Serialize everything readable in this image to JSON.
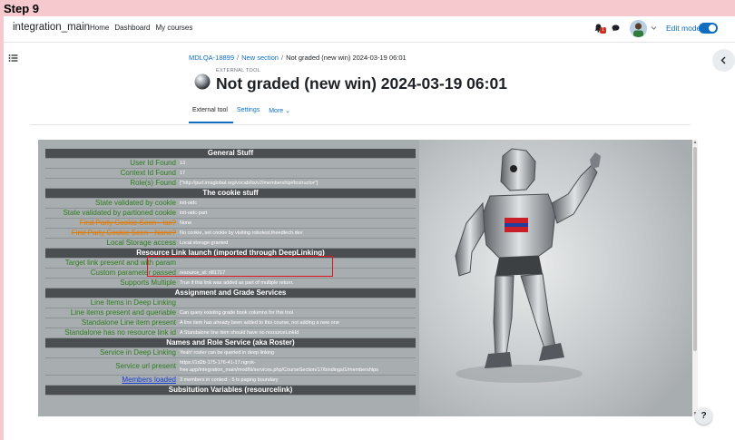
{
  "step_label": "Step 9",
  "topnav": {
    "site_name": "integration_main",
    "links": [
      "Home",
      "Dashboard",
      "My courses"
    ],
    "notification_count": "1",
    "edit_mode_label": "Edit mode"
  },
  "breadcrumb": {
    "items": [
      "MDLQA-18899",
      "New section",
      "Not graded (new win) 2024-03-19 06:01"
    ],
    "separator": "/"
  },
  "header": {
    "activity_type": "EXTERNAL TOOL",
    "title": "Not graded (new win) 2024-03-19 06:01"
  },
  "tabs": [
    "External tool",
    "Settings",
    "More ⌄"
  ],
  "help_label": "?",
  "tool": {
    "rows": [
      {
        "kind": "header",
        "label": "General Stuff"
      },
      {
        "key": "User Id Found",
        "value": "13"
      },
      {
        "key": "Context Id Found",
        "value": "17"
      },
      {
        "key": "Role(s) Found",
        "value": "[\"http://purl.imsglobal.org/vocab/lis/v2/membership#Instructor\"]"
      },
      {
        "kind": "header",
        "label": "The cookie stuff"
      },
      {
        "key": "State validated by cookie",
        "value": "init-oidc"
      },
      {
        "key": "State validated by partioned cookie",
        "value": "init-oidc-part"
      },
      {
        "key": "First Party Cookie Seen - lax?",
        "value": "None",
        "style": "strike"
      },
      {
        "key": "First Party Cookie Seen - None?",
        "value": "No cookie, set cookie by visiting robotest.theedtech.dev",
        "style": "strike"
      },
      {
        "key": "Local Storage access",
        "value": "Local storage granted"
      },
      {
        "kind": "header",
        "label": "Resource Link launch (imported through DeepLinking)"
      },
      {
        "key": "Target link present and with param",
        "value": ""
      },
      {
        "key": "Custom parameter passed",
        "value": "resource_id: rl81717"
      },
      {
        "key": "Supports Multiple",
        "value": "True if this link was added as part of multiple return."
      },
      {
        "kind": "header",
        "label": "Assignment and Grade Services"
      },
      {
        "key": "Line Items in Deep Linking",
        "value": ""
      },
      {
        "key": "Line items present and queriable",
        "value": "Can query existing grade book columns for this tool"
      },
      {
        "key": "Standalone Line item present",
        "value": "A line item has already been added to this course, not adding a new one"
      },
      {
        "key": "Standalone has no resource link id",
        "value": "A Standalone line item should have no resourceLinkId"
      },
      {
        "kind": "header",
        "label": "Names and Role Service (aka Roster)"
      },
      {
        "key": "Service in Deep Linking",
        "value": "Yeah! roster can be queried in deep linking"
      },
      {
        "key": "Service url present",
        "value": "https://1d2b-175-176-41-17.ngrok-free.app/integration_main/mod/lti/services.php/CourseSection/17/bindings/1/memberships",
        "style": "tall"
      },
      {
        "key": "Members loaded",
        "value": "3 members in context - 5 is paging boundary",
        "style": "link"
      },
      {
        "kind": "header",
        "label": "Subsitution Variables (resourcelink)"
      }
    ]
  },
  "colors": {
    "accent": "#0f6cbf",
    "background_frame": "#f5c9cd",
    "highlight_box": "#e0141c",
    "key_text": "#2e7d1f"
  }
}
